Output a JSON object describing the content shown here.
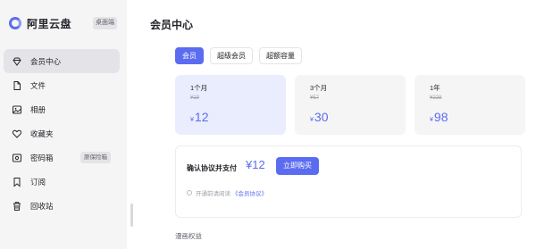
{
  "app": {
    "name": "阿里云盘",
    "badge": "桌面端"
  },
  "sidebar": {
    "items": [
      {
        "label": "会员中心",
        "icon": "diamond-icon",
        "active": true
      },
      {
        "label": "文件",
        "icon": "file-icon"
      },
      {
        "label": "相册",
        "icon": "photo-icon"
      },
      {
        "label": "收藏夹",
        "icon": "heart-icon"
      },
      {
        "label": "密码箱",
        "icon": "safe-icon",
        "tag": "原保险箱"
      },
      {
        "label": "订阅",
        "icon": "bookmark-icon"
      },
      {
        "label": "回收站",
        "icon": "trash-icon"
      }
    ]
  },
  "main": {
    "title": "会员中心",
    "tabs": [
      {
        "label": "会员",
        "active": true
      },
      {
        "label": "超级会员"
      },
      {
        "label": "超额容量"
      }
    ],
    "plans": [
      {
        "period": "1个月",
        "original": "¥19",
        "currency": "¥",
        "price": "12",
        "selected": true
      },
      {
        "period": "3个月",
        "original": "¥57",
        "currency": "¥",
        "price": "30"
      },
      {
        "period": "1年",
        "original": "¥228",
        "currency": "¥",
        "price": "98"
      }
    ],
    "payment": {
      "label": "确认协议并支付",
      "price": "¥12",
      "buy_button": "立即购买",
      "agreement_text": "开通前请阅读",
      "agreement_link": "《会员协议》"
    },
    "benefits_title": "漫画权益"
  },
  "colors": {
    "accent": "#5b6cf0",
    "sidebar_bg": "#f5f5f6",
    "selected_card": "#eaedfd"
  }
}
